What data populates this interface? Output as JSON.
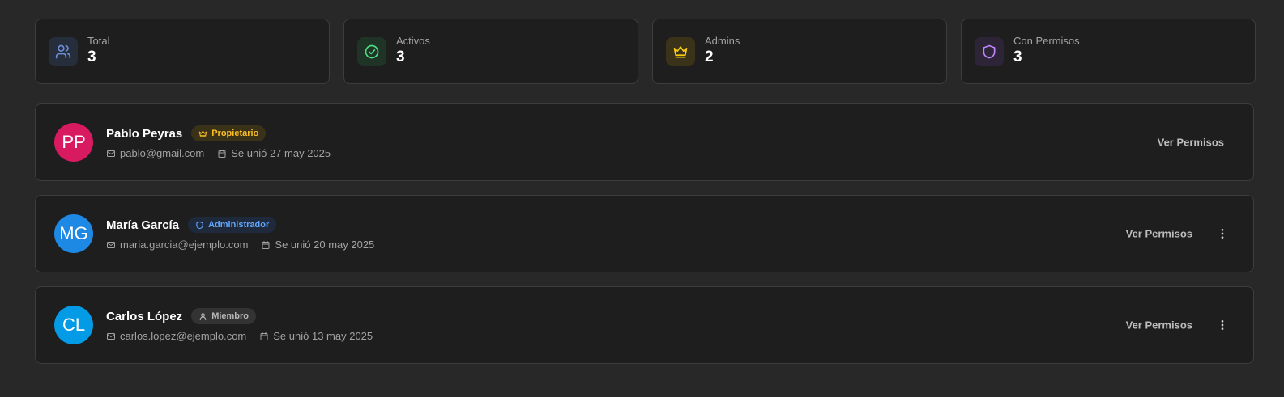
{
  "stats": [
    {
      "label": "Total",
      "value": "3",
      "icon": "users-icon",
      "color": "#6b8fd6",
      "bg": "#262d3b"
    },
    {
      "label": "Activos",
      "value": "3",
      "icon": "check-circle-icon",
      "color": "#4ade80",
      "bg": "#1f3326"
    },
    {
      "label": "Admins",
      "value": "2",
      "icon": "crown-icon",
      "color": "#facc15",
      "bg": "#3a3219"
    },
    {
      "label": "Con Permisos",
      "value": "3",
      "icon": "shield-icon",
      "color": "#c084fc",
      "bg": "#2e2438"
    }
  ],
  "members": [
    {
      "initials": "PP",
      "avatar_color": "#d81b60",
      "name": "Pablo Peyras",
      "role": "Propietario",
      "role_icon": "crown-icon",
      "role_type": "owner",
      "email": "pablo@gmail.com",
      "joined": "Se unió 27 may 2025",
      "action": "Ver Permisos",
      "has_menu": false
    },
    {
      "initials": "MG",
      "avatar_color": "#1e88e5",
      "name": "María García",
      "role": "Administrador",
      "role_icon": "shield-icon",
      "role_type": "admin",
      "email": "maria.garcia@ejemplo.com",
      "joined": "Se unió 20 may 2025",
      "action": "Ver Permisos",
      "has_menu": true
    },
    {
      "initials": "CL",
      "avatar_color": "#039be5",
      "name": "Carlos López",
      "role": "Miembro",
      "role_icon": "user-icon",
      "role_type": "member",
      "email": "carlos.lopez@ejemplo.com",
      "joined": "Se unió 13 may 2025",
      "action": "Ver Permisos",
      "has_menu": true
    }
  ]
}
